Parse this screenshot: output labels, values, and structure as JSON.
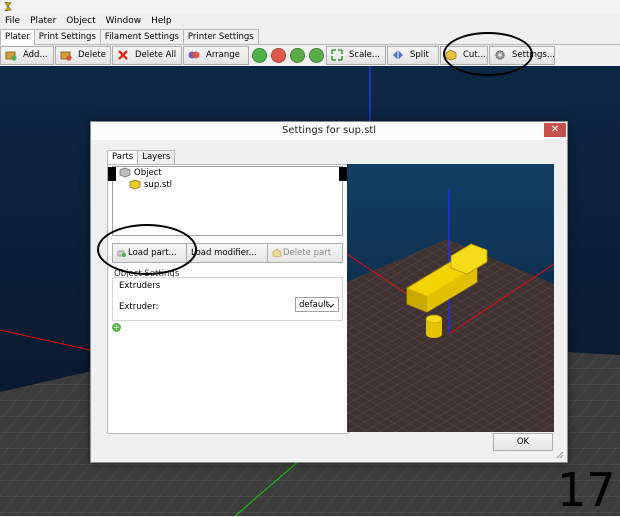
{
  "menu": [
    "File",
    "Plater",
    "Object",
    "Window",
    "Help"
  ],
  "tabs": [
    "Plater",
    "Print Settings",
    "Filament Settings",
    "Printer Settings"
  ],
  "toolbar": {
    "add": "Add...",
    "delete": "Delete",
    "delete_all": "Delete All",
    "arrange": "Arrange",
    "scale": "Scale...",
    "split": "Split",
    "cut": "Cut...",
    "settings": "Settings..."
  },
  "dialog": {
    "title": "Settings for sup.stl",
    "close_glyph": "✕",
    "tabs": [
      "Parts",
      "Layers"
    ],
    "tree": {
      "root": "Object",
      "child": "sup.stl"
    },
    "buttons": {
      "load_part": "Load part...",
      "load_modifier": "Load modifier...",
      "delete_part": "Delete part"
    },
    "object_settings_label": "Object Settings",
    "extruders_title": "Extruders",
    "extruder_label": "Extruder:",
    "extruder_value": "default",
    "ok": "OK"
  },
  "annotation_number": "17",
  "colors": {
    "part_yellow": "#f2d500",
    "viewport_bg": "#10213d",
    "close_red": "#c75050"
  }
}
